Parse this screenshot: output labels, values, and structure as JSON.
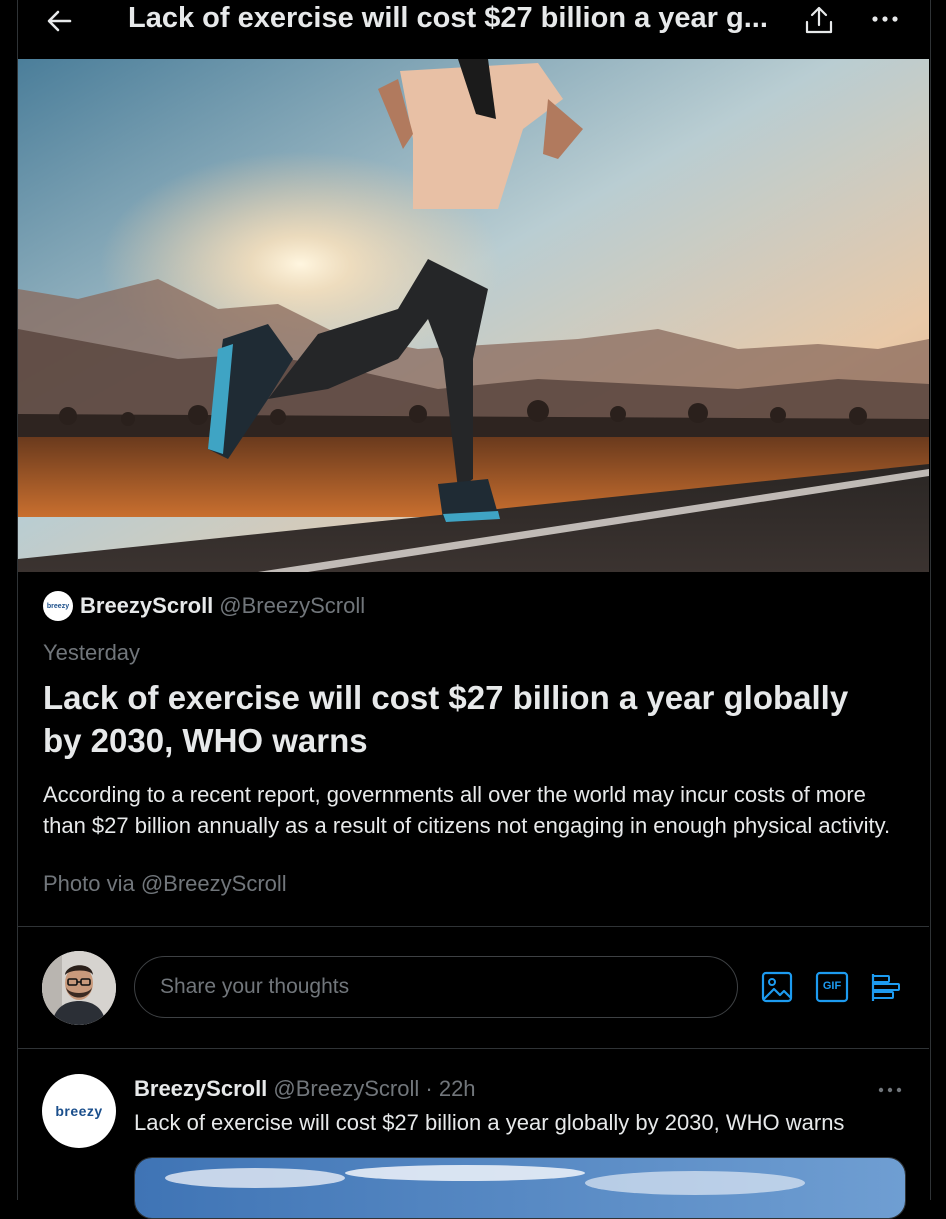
{
  "header": {
    "title": "Lack of exercise will cost $27 billion a year g..."
  },
  "hero": {
    "alt": "Runner on a road at sunset with mountains"
  },
  "article": {
    "source_logo_text": "breezy",
    "source_name": "BreezyScroll",
    "source_handle": "@BreezyScroll",
    "timestamp": "Yesterday",
    "headline": "Lack of exercise will cost $27 billion a year globally by 2030, WHO warns",
    "summary": "According to a recent report, governments all over the world may incur costs of more than $27 billion annually as a result of citizens not engaging in enough physical activity.",
    "credit": "Photo via @BreezyScroll"
  },
  "composer": {
    "placeholder": "Share your thoughts",
    "tools": [
      "image-icon",
      "gif-icon",
      "poll-icon"
    ],
    "gif_label": "GIF"
  },
  "tweet": {
    "avatar_text": "breezy",
    "name": "BreezyScroll",
    "handle": "@BreezyScroll",
    "separator": "·",
    "time": "22h",
    "text": "Lack of exercise will cost $27 billion a year globally by 2030, WHO warns"
  },
  "colors": {
    "background": "#000000",
    "text_primary": "#e7e9ea",
    "text_secondary": "#71767b",
    "accent": "#1d9bf0",
    "border": "#2f3336"
  }
}
